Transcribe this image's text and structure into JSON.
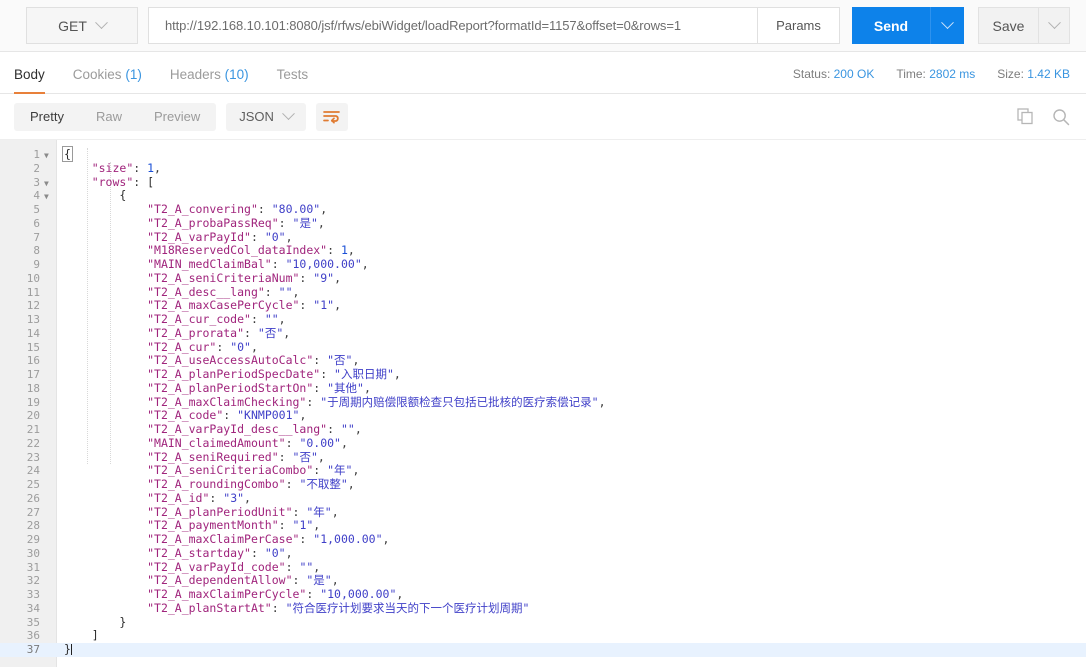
{
  "request": {
    "method": "GET",
    "url": "http://192.168.10.101:8080/jsf/rfws/ebiWidget/loadReport?formatId=1157&offset=0&rows=1",
    "params_label": "Params",
    "send_label": "Send",
    "save_label": "Save"
  },
  "response_tabs": [
    {
      "label": "Body",
      "count": ""
    },
    {
      "label": "Cookies",
      "count": "(1)"
    },
    {
      "label": "Headers",
      "count": "(10)"
    },
    {
      "label": "Tests",
      "count": ""
    }
  ],
  "status": {
    "status_label": "Status:",
    "status_value": "200 OK",
    "time_label": "Time:",
    "time_value": "2802 ms",
    "size_label": "Size:",
    "size_value": "1.42 KB"
  },
  "format_bar": {
    "modes": [
      "Pretty",
      "Raw",
      "Preview"
    ],
    "active_mode": "Pretty",
    "language": "JSON",
    "wrap_icon": "wrap-lines-icon",
    "copy_icon": "copy-icon",
    "search_icon": "search-icon"
  },
  "colors": {
    "accent_blue": "#0d82ea",
    "tab_underline": "#e8803a",
    "link_blue": "#3a95e0",
    "json_key": "#a0247c",
    "json_string": "#4040c8",
    "json_number": "#1a4fd6",
    "active_line": "#e8f2fe"
  },
  "body": {
    "language": "JSON",
    "total_lines": 37,
    "active_line": 37,
    "lines": [
      {
        "n": 1,
        "fold": true,
        "indent": 0,
        "raw": "{"
      },
      {
        "n": 2,
        "fold": false,
        "indent": 1,
        "key": "size",
        "value": "1",
        "vtype": "number",
        "comma": true
      },
      {
        "n": 3,
        "fold": true,
        "indent": 1,
        "key": "rows",
        "value": "[",
        "vtype": "open"
      },
      {
        "n": 4,
        "fold": true,
        "indent": 2,
        "raw": "{"
      },
      {
        "n": 5,
        "fold": false,
        "indent": 3,
        "key": "T2_A_convering",
        "value": "80.00",
        "vtype": "string",
        "comma": true
      },
      {
        "n": 6,
        "fold": false,
        "indent": 3,
        "key": "T2_A_probaPassReq",
        "value": "是",
        "vtype": "string",
        "comma": true
      },
      {
        "n": 7,
        "fold": false,
        "indent": 3,
        "key": "T2_A_varPayId",
        "value": "0",
        "vtype": "string",
        "comma": true
      },
      {
        "n": 8,
        "fold": false,
        "indent": 3,
        "key": "M18ReservedCol_dataIndex",
        "value": "1",
        "vtype": "number",
        "comma": true
      },
      {
        "n": 9,
        "fold": false,
        "indent": 3,
        "key": "MAIN_medClaimBal",
        "value": "10,000.00",
        "vtype": "string",
        "comma": true
      },
      {
        "n": 10,
        "fold": false,
        "indent": 3,
        "key": "T2_A_seniCriteriaNum",
        "value": "9",
        "vtype": "string",
        "comma": true
      },
      {
        "n": 11,
        "fold": false,
        "indent": 3,
        "key": "T2_A_desc__lang",
        "value": "",
        "vtype": "string",
        "comma": true
      },
      {
        "n": 12,
        "fold": false,
        "indent": 3,
        "key": "T2_A_maxCasePerCycle",
        "value": "1",
        "vtype": "string",
        "comma": true
      },
      {
        "n": 13,
        "fold": false,
        "indent": 3,
        "key": "T2_A_cur_code",
        "value": "",
        "vtype": "string",
        "comma": true
      },
      {
        "n": 14,
        "fold": false,
        "indent": 3,
        "key": "T2_A_prorata",
        "value": "否",
        "vtype": "string",
        "comma": true
      },
      {
        "n": 15,
        "fold": false,
        "indent": 3,
        "key": "T2_A_cur",
        "value": "0",
        "vtype": "string",
        "comma": true
      },
      {
        "n": 16,
        "fold": false,
        "indent": 3,
        "key": "T2_A_useAccessAutoCalc",
        "value": "否",
        "vtype": "string",
        "comma": true
      },
      {
        "n": 17,
        "fold": false,
        "indent": 3,
        "key": "T2_A_planPeriodSpecDate",
        "value": "入职日期",
        "vtype": "string",
        "comma": true
      },
      {
        "n": 18,
        "fold": false,
        "indent": 3,
        "key": "T2_A_planPeriodStartOn",
        "value": "其他",
        "vtype": "string",
        "comma": true
      },
      {
        "n": 19,
        "fold": false,
        "indent": 3,
        "key": "T2_A_maxClaimChecking",
        "value": "于周期内赔偿限额检查只包括已批核的医疗索偿记录",
        "vtype": "string",
        "comma": true
      },
      {
        "n": 20,
        "fold": false,
        "indent": 3,
        "key": "T2_A_code",
        "value": "KNMP001",
        "vtype": "string",
        "comma": true
      },
      {
        "n": 21,
        "fold": false,
        "indent": 3,
        "key": "T2_A_varPayId_desc__lang",
        "value": "",
        "vtype": "string",
        "comma": true
      },
      {
        "n": 22,
        "fold": false,
        "indent": 3,
        "key": "MAIN_claimedAmount",
        "value": "0.00",
        "vtype": "string",
        "comma": true
      },
      {
        "n": 23,
        "fold": false,
        "indent": 3,
        "key": "T2_A_seniRequired",
        "value": "否",
        "vtype": "string",
        "comma": true
      },
      {
        "n": 24,
        "fold": false,
        "indent": 3,
        "key": "T2_A_seniCriteriaCombo",
        "value": "年",
        "vtype": "string",
        "comma": true
      },
      {
        "n": 25,
        "fold": false,
        "indent": 3,
        "key": "T2_A_roundingCombo",
        "value": "不取整",
        "vtype": "string",
        "comma": true
      },
      {
        "n": 26,
        "fold": false,
        "indent": 3,
        "key": "T2_A_id",
        "value": "3",
        "vtype": "string",
        "comma": true
      },
      {
        "n": 27,
        "fold": false,
        "indent": 3,
        "key": "T2_A_planPeriodUnit",
        "value": "年",
        "vtype": "string",
        "comma": true
      },
      {
        "n": 28,
        "fold": false,
        "indent": 3,
        "key": "T2_A_paymentMonth",
        "value": "1",
        "vtype": "string",
        "comma": true
      },
      {
        "n": 29,
        "fold": false,
        "indent": 3,
        "key": "T2_A_maxClaimPerCase",
        "value": "1,000.00",
        "vtype": "string",
        "comma": true
      },
      {
        "n": 30,
        "fold": false,
        "indent": 3,
        "key": "T2_A_startday",
        "value": "0",
        "vtype": "string",
        "comma": true
      },
      {
        "n": 31,
        "fold": false,
        "indent": 3,
        "key": "T2_A_varPayId_code",
        "value": "",
        "vtype": "string",
        "comma": true
      },
      {
        "n": 32,
        "fold": false,
        "indent": 3,
        "key": "T2_A_dependentAllow",
        "value": "是",
        "vtype": "string",
        "comma": true
      },
      {
        "n": 33,
        "fold": false,
        "indent": 3,
        "key": "T2_A_maxClaimPerCycle",
        "value": "10,000.00",
        "vtype": "string",
        "comma": true
      },
      {
        "n": 34,
        "fold": false,
        "indent": 3,
        "key": "T2_A_planStartAt",
        "value": "符合医疗计划要求当天的下一个医疗计划周期",
        "vtype": "string",
        "comma": false
      },
      {
        "n": 35,
        "fold": false,
        "indent": 2,
        "raw": "}"
      },
      {
        "n": 36,
        "fold": false,
        "indent": 1,
        "raw": "]"
      },
      {
        "n": 37,
        "fold": false,
        "indent": 0,
        "raw": "}",
        "cursor": true
      }
    ]
  }
}
